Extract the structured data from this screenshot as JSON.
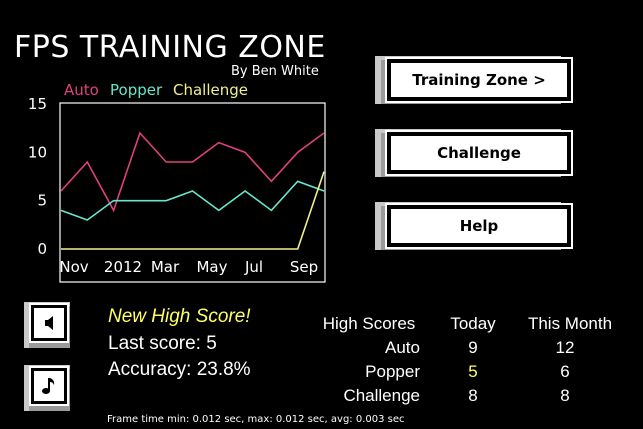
{
  "header": {
    "title": "FPS TRAINING ZONE",
    "author": "By Ben White"
  },
  "colors": {
    "auto": "#e0407f",
    "popper": "#66e6cc",
    "challenge": "#f2f08a",
    "highlight": "#ffff66"
  },
  "chart_data": {
    "type": "line",
    "x_tick_labels": [
      "Nov",
      "2012",
      "Mar",
      "May",
      "Jul",
      "Sep"
    ],
    "y_tick_labels": [
      "0",
      "5",
      "10",
      "15"
    ],
    "ylim": [
      0,
      15
    ],
    "grid": false,
    "legend_placement": "top-left, above plot",
    "series": [
      {
        "name": "Auto",
        "color": "#e0407f",
        "values": [
          6,
          9,
          4,
          12,
          9,
          9,
          11,
          10,
          7,
          10,
          12
        ]
      },
      {
        "name": "Popper",
        "color": "#66e6cc",
        "values": [
          4,
          3,
          5,
          5,
          5,
          6,
          4,
          6,
          4,
          7,
          6
        ]
      },
      {
        "name": "Challenge",
        "color": "#f2f08a",
        "values": [
          0,
          0,
          0,
          0,
          0,
          0,
          0,
          0,
          0,
          0,
          8
        ]
      }
    ]
  },
  "menu": {
    "training_zone": "Training Zone  >",
    "challenge": "Challenge",
    "help": "Help"
  },
  "icons": {
    "sound": "speaker-icon",
    "music": "music-note-icon"
  },
  "stats": {
    "new_high_score": "New High Score!",
    "last_score": "Last score: 5",
    "accuracy": "Accuracy: 23.8%"
  },
  "high_scores": {
    "header": "High Scores",
    "columns": [
      "Today",
      "This Month"
    ],
    "rows": [
      {
        "label": "Auto",
        "today": "9",
        "month": "12"
      },
      {
        "label": "Popper",
        "today": "5",
        "month": "6"
      },
      {
        "label": "Challenge",
        "today": "8",
        "month": "8"
      }
    ]
  },
  "footer": {
    "frame_time": "Frame time min: 0.012 sec, max: 0.012 sec, avg: 0.003 sec"
  }
}
